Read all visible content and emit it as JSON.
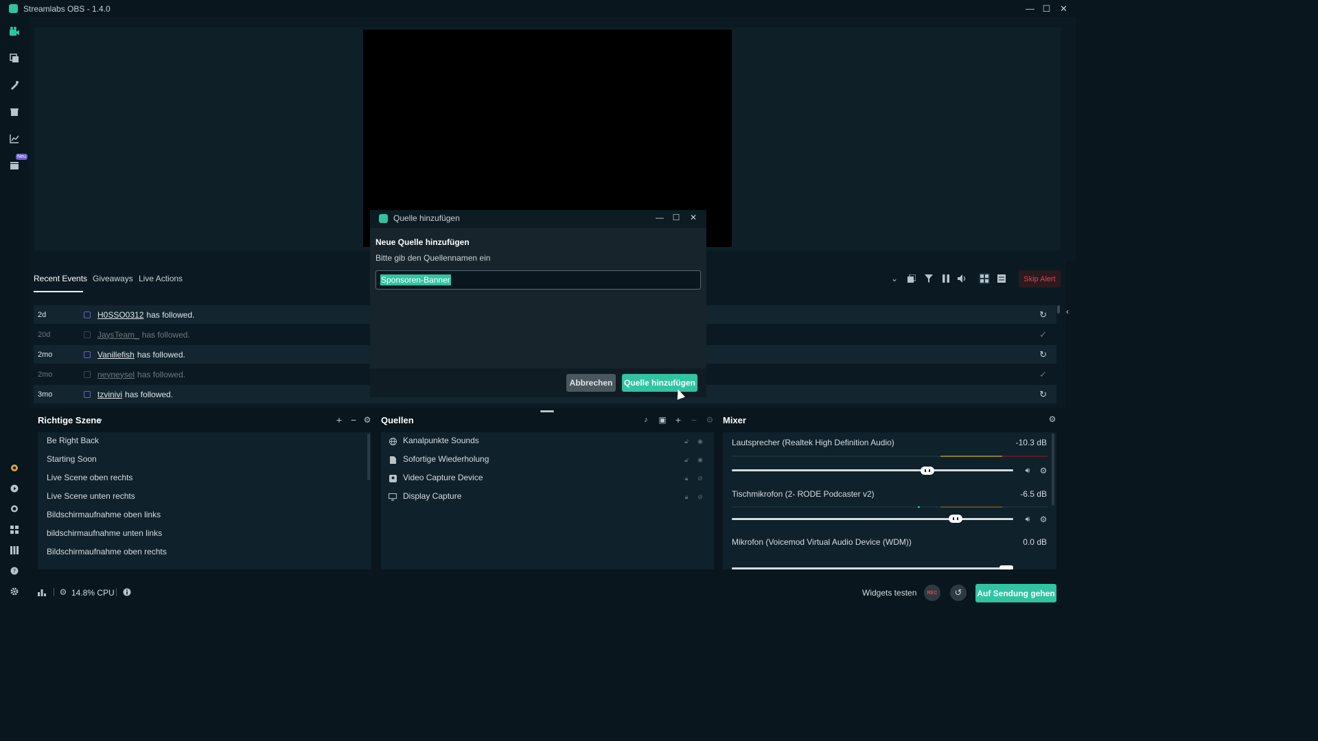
{
  "window": {
    "title": "Streamlabs OBS - 1.4.0",
    "minimize": "—",
    "maximize": "☐",
    "close": "✕"
  },
  "sidebar": {
    "neu_badge": "Neu"
  },
  "events": {
    "tabs": [
      {
        "label": "Recent Events"
      },
      {
        "label": "Giveaways"
      },
      {
        "label": "Live Actions"
      }
    ],
    "skip_alert": "Skip Alert",
    "rows": [
      {
        "age": "2d",
        "name": "H0SSO0312",
        "text": "has followed.",
        "faded": false,
        "action": "↻"
      },
      {
        "age": "20d",
        "name": "JaysTeam_",
        "text": "has followed.",
        "faded": true,
        "action": "✓"
      },
      {
        "age": "2mo",
        "name": "Vanillefish",
        "text": "has followed.",
        "faded": false,
        "action": "↻"
      },
      {
        "age": "2mo",
        "name": "neyneysel",
        "text": "has followed.",
        "faded": true,
        "action": "✓"
      },
      {
        "age": "3mo",
        "name": "tzvinivi",
        "text": "has followed.",
        "faded": false,
        "action": "↻"
      }
    ]
  },
  "scenes": {
    "title": "Richtige Szene",
    "items": [
      "Be Right Back",
      "Starting Soon",
      "Live Scene oben rechts",
      "Live Scene unten rechts",
      "Bildschirmaufnahme oben links",
      "bildschirmaufnahme unten links",
      "Bildschirmaufnahme oben rechts"
    ]
  },
  "sources": {
    "title": "Quellen",
    "items": [
      {
        "label": "Kanalpunkte Sounds",
        "icon": "globe-icon"
      },
      {
        "label": "Sofortige Wiederholung",
        "icon": "file-icon"
      },
      {
        "label": "Video Capture Device",
        "icon": "camera-icon"
      },
      {
        "label": "Display Capture",
        "icon": "monitor-icon"
      }
    ]
  },
  "mixer": {
    "title": "Mixer",
    "channels": [
      {
        "name": "Lautsprecher (Realtek High Definition Audio)",
        "db": "-10.3 dB",
        "level": 0.72
      },
      {
        "name": "Tischmikrofon (2- RODE Podcaster v2)",
        "db": "-6.5 dB",
        "level": 0.82
      },
      {
        "name": "Mikrofon (Voicemod Virtual Audio Device (WDM))",
        "db": "0.0 dB",
        "level": 1.0
      }
    ]
  },
  "status": {
    "cpu": "14.8% CPU",
    "widgets_test": "Widgets testen",
    "rec": "REC",
    "go_live": "Auf Sendung gehen"
  },
  "modal": {
    "title": "Quelle hinzufügen",
    "heading": "Neue Quelle hinzufügen",
    "subtitle": "Bitte gib den Quellennamen ein",
    "input_value": "Sponsoren-Banner",
    "cancel": "Abbrechen",
    "confirm": "Quelle hinzufügen"
  },
  "colors": {
    "accent": "#31c3a2",
    "background": "#09161d",
    "panel": "#0f212b",
    "danger": "#e3424e"
  }
}
